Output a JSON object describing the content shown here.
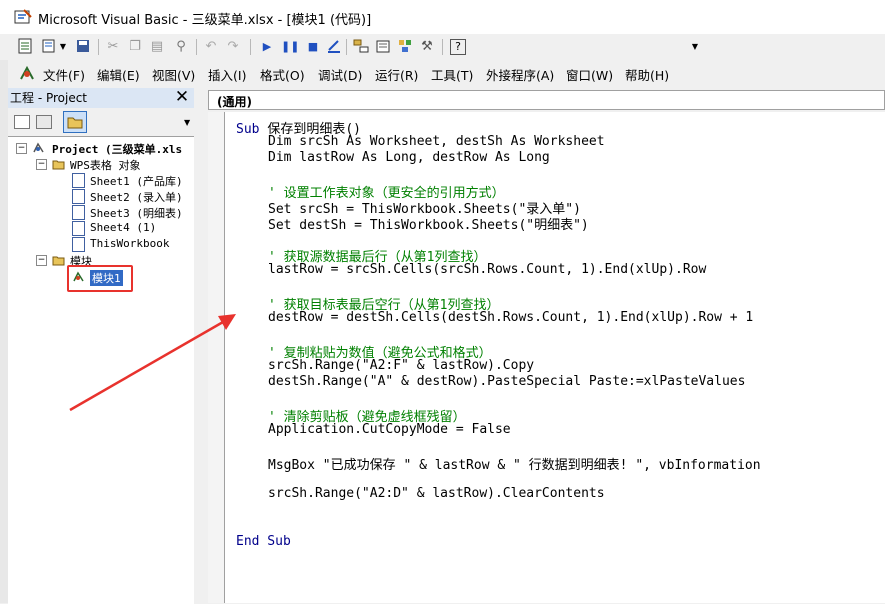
{
  "window": {
    "title": "Microsoft Visual Basic - 三级菜单.xlsx - [模块1 (代码)]"
  },
  "menu": [
    "文件(F)",
    "编辑(E)",
    "视图(V)",
    "插入(I)",
    "格式(O)",
    "调试(D)",
    "运行(R)",
    "工具(T)",
    "外接程序(A)",
    "窗口(W)",
    "帮助(H)"
  ],
  "project": {
    "title": "工程 - Project",
    "root": "Project (三级菜单.xls",
    "wps_folder": "WPS表格 对象",
    "sheets": [
      "Sheet1 (产品库)",
      "Sheet2 (录入单)",
      "Sheet3 (明细表)",
      "Sheet4 (1)",
      "ThisWorkbook"
    ],
    "module_folder": "模块",
    "module": "模块1"
  },
  "code": {
    "scope": "(通用)",
    "lines": [
      {
        "k": "Sub ",
        "t": "保存到明细表()",
        "indent": 0
      },
      {
        "k": "",
        "t": "Dim srcSh As Worksheet, destSh As Worksheet",
        "indent": 1
      },
      {
        "k": "",
        "t": "Dim lastRow As Long, destRow As Long",
        "indent": 1
      },
      {
        "k": "",
        "t": "",
        "indent": 0
      },
      {
        "c": "' 设置工作表对象（更安全的引用方式）",
        "indent": 1
      },
      {
        "k": "",
        "t": "Set srcSh = ThisWorkbook.Sheets(\"录入单\")",
        "indent": 1
      },
      {
        "k": "",
        "t": "Set destSh = ThisWorkbook.Sheets(\"明细表\")",
        "indent": 1
      },
      {
        "k": "",
        "t": "",
        "indent": 0
      },
      {
        "c": "' 获取源数据最后行（从第1列查找）",
        "indent": 1
      },
      {
        "k": "",
        "t": "lastRow = srcSh.Cells(srcSh.Rows.Count, 1).End(xlUp).Row",
        "indent": 1
      },
      {
        "k": "",
        "t": "",
        "indent": 0
      },
      {
        "c": "' 获取目标表最后空行（从第1列查找）",
        "indent": 1
      },
      {
        "k": "",
        "t": "destRow = destSh.Cells(destSh.Rows.Count, 1).End(xlUp).Row + 1",
        "indent": 1
      },
      {
        "k": "",
        "t": "",
        "indent": 0
      },
      {
        "c": "' 复制粘贴为数值（避免公式和格式）",
        "indent": 1
      },
      {
        "k": "",
        "t": "srcSh.Range(\"A2:F\" & lastRow).Copy",
        "indent": 1
      },
      {
        "k": "",
        "t": "destSh.Range(\"A\" & destRow).PasteSpecial Paste:=xlPasteValues",
        "indent": 1
      },
      {
        "k": "",
        "t": "",
        "indent": 0
      },
      {
        "c": "' 清除剪贴板（避免虚线框残留）",
        "indent": 1
      },
      {
        "k": "",
        "t": "Application.CutCopyMode = False",
        "indent": 1
      },
      {
        "k": "",
        "t": "",
        "indent": 0
      },
      {
        "k": "",
        "t": "MsgBox \"已成功保存 \" & lastRow & \" 行数据到明细表! \", vbInformation",
        "indent": 1
      },
      {
        "k": "",
        "t": "",
        "indent": 0
      },
      {
        "k": "",
        "t": "srcSh.Range(\"A2:D\" & lastRow).ClearContents",
        "indent": 1
      },
      {
        "k": "",
        "t": "",
        "indent": 0
      },
      {
        "k": "",
        "t": "",
        "indent": 0
      },
      {
        "k": "End Sub",
        "t": "",
        "indent": 0
      }
    ]
  },
  "colors": {
    "highlight": "#316ac5",
    "annotation": "#e8322d",
    "keyword": "#00008b",
    "comment": "#008000"
  }
}
